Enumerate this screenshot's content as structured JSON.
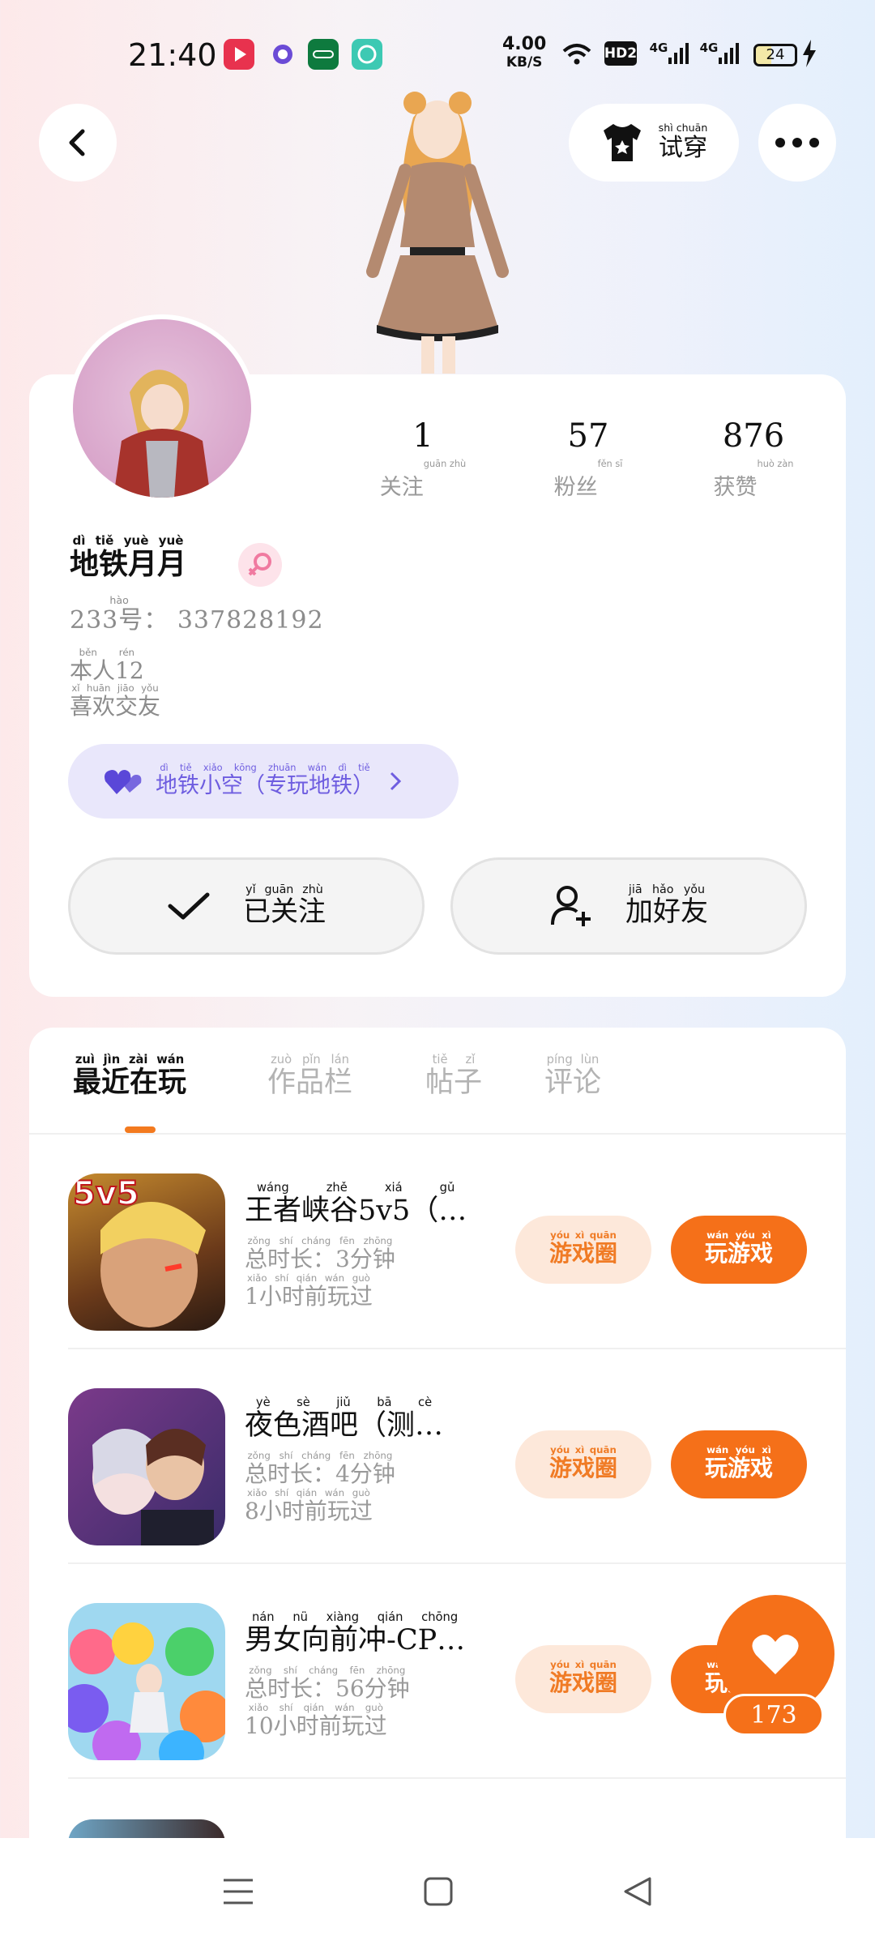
{
  "status_bar": {
    "time": "21:40",
    "network_speed": "4.00",
    "network_unit": "KB/S",
    "hd_badge": "HD2",
    "signal1": "4G",
    "signal2": "4G",
    "battery": "24",
    "app_icons": [
      "video-app-icon",
      "planet-app-icon",
      "oppo-app-icon",
      "chat-app-icon"
    ]
  },
  "header": {
    "back_icon": "chevron-left-icon",
    "tryon": {
      "icon": "tshirt-icon",
      "label": "试穿",
      "pinyin": "shì chuān"
    },
    "more_icon": "more-dots-icon"
  },
  "profile": {
    "stats": [
      {
        "value": "1",
        "label": "关注",
        "pinyin": "guān zhù"
      },
      {
        "value": "57",
        "label": "粉丝",
        "pinyin": "fěn sī"
      },
      {
        "value": "876",
        "label": "获赞",
        "pinyin": "huò zàn"
      }
    ],
    "nickname": "地铁月月",
    "nickname_pinyin": "dì tiě yuè yuè",
    "gender_icon": "female-icon",
    "uid_label": "233号：",
    "uid_label_pinyin": "hào",
    "uid_value": "337828192",
    "bio_line1": "本人12",
    "bio_line1_pinyin": "běn rén",
    "bio_line2": "喜欢交友",
    "bio_line2_pinyin": "xǐ huān jiāo yǒu",
    "group": {
      "icon": "hearts-icon",
      "label": "地铁小空（专玩地铁）",
      "pinyin": "dì tiě xiǎo kōng zhuān wán dì tiě"
    },
    "follow_button": {
      "icon": "check-icon",
      "label": "已关注",
      "pinyin": "yǐ guān zhù"
    },
    "add_friend_button": {
      "icon": "add-person-icon",
      "label": "加好友",
      "pinyin": "jiā hǎo yǒu"
    }
  },
  "tabs": [
    {
      "label": "最近在玩",
      "pinyin": "zuì jìn zài wán",
      "active": true
    },
    {
      "label": "作品栏",
      "pinyin": "zuò pǐn lán",
      "active": false
    },
    {
      "label": "帖子",
      "pinyin": "tiě zǐ",
      "active": false
    },
    {
      "label": "评论",
      "pinyin": "píng lùn",
      "active": false
    }
  ],
  "games": [
    {
      "title": "王者峡谷5v5（…",
      "title_pinyin": "wáng zhě xiá gǔ",
      "duration": "总时长：3分钟",
      "duration_pinyin": "zǒng shí cháng  fēn zhōng",
      "last_played": "1小时前玩过",
      "last_played_pinyin": "xiǎo shí qián wán guò",
      "icon_badge": "5v5"
    },
    {
      "title": "夜色酒吧（测…",
      "title_pinyin": "yè sè jiǔ bā  cè",
      "duration": "总时长：4分钟",
      "duration_pinyin": "zǒng shí cháng  fēn zhōng",
      "last_played": "8小时前玩过",
      "last_played_pinyin": "xiǎo shí qián wán guò",
      "icon_badge": ""
    },
    {
      "title": "男女向前冲-CP…",
      "title_pinyin": "nán nǚ xiàng qián chōng",
      "duration": "总时长：56分钟",
      "duration_pinyin": "zǒng shí cháng  fēn zhōng",
      "last_played": "10小时前玩过",
      "last_played_pinyin": "xiǎo shí qián wán guò",
      "icon_badge": ""
    }
  ],
  "game_buttons": {
    "circle_label": "游戏圈",
    "circle_pinyin": "yóu xì quān",
    "play_label": "玩游戏",
    "play_pinyin": "wán yóu xì"
  },
  "like_fab": {
    "icon": "heart-icon",
    "count": "173"
  },
  "nav": [
    "menu-icon",
    "home-square-icon",
    "back-triangle-icon"
  ],
  "colors": {
    "accent": "#f57019",
    "purple": "#6e5de0"
  }
}
